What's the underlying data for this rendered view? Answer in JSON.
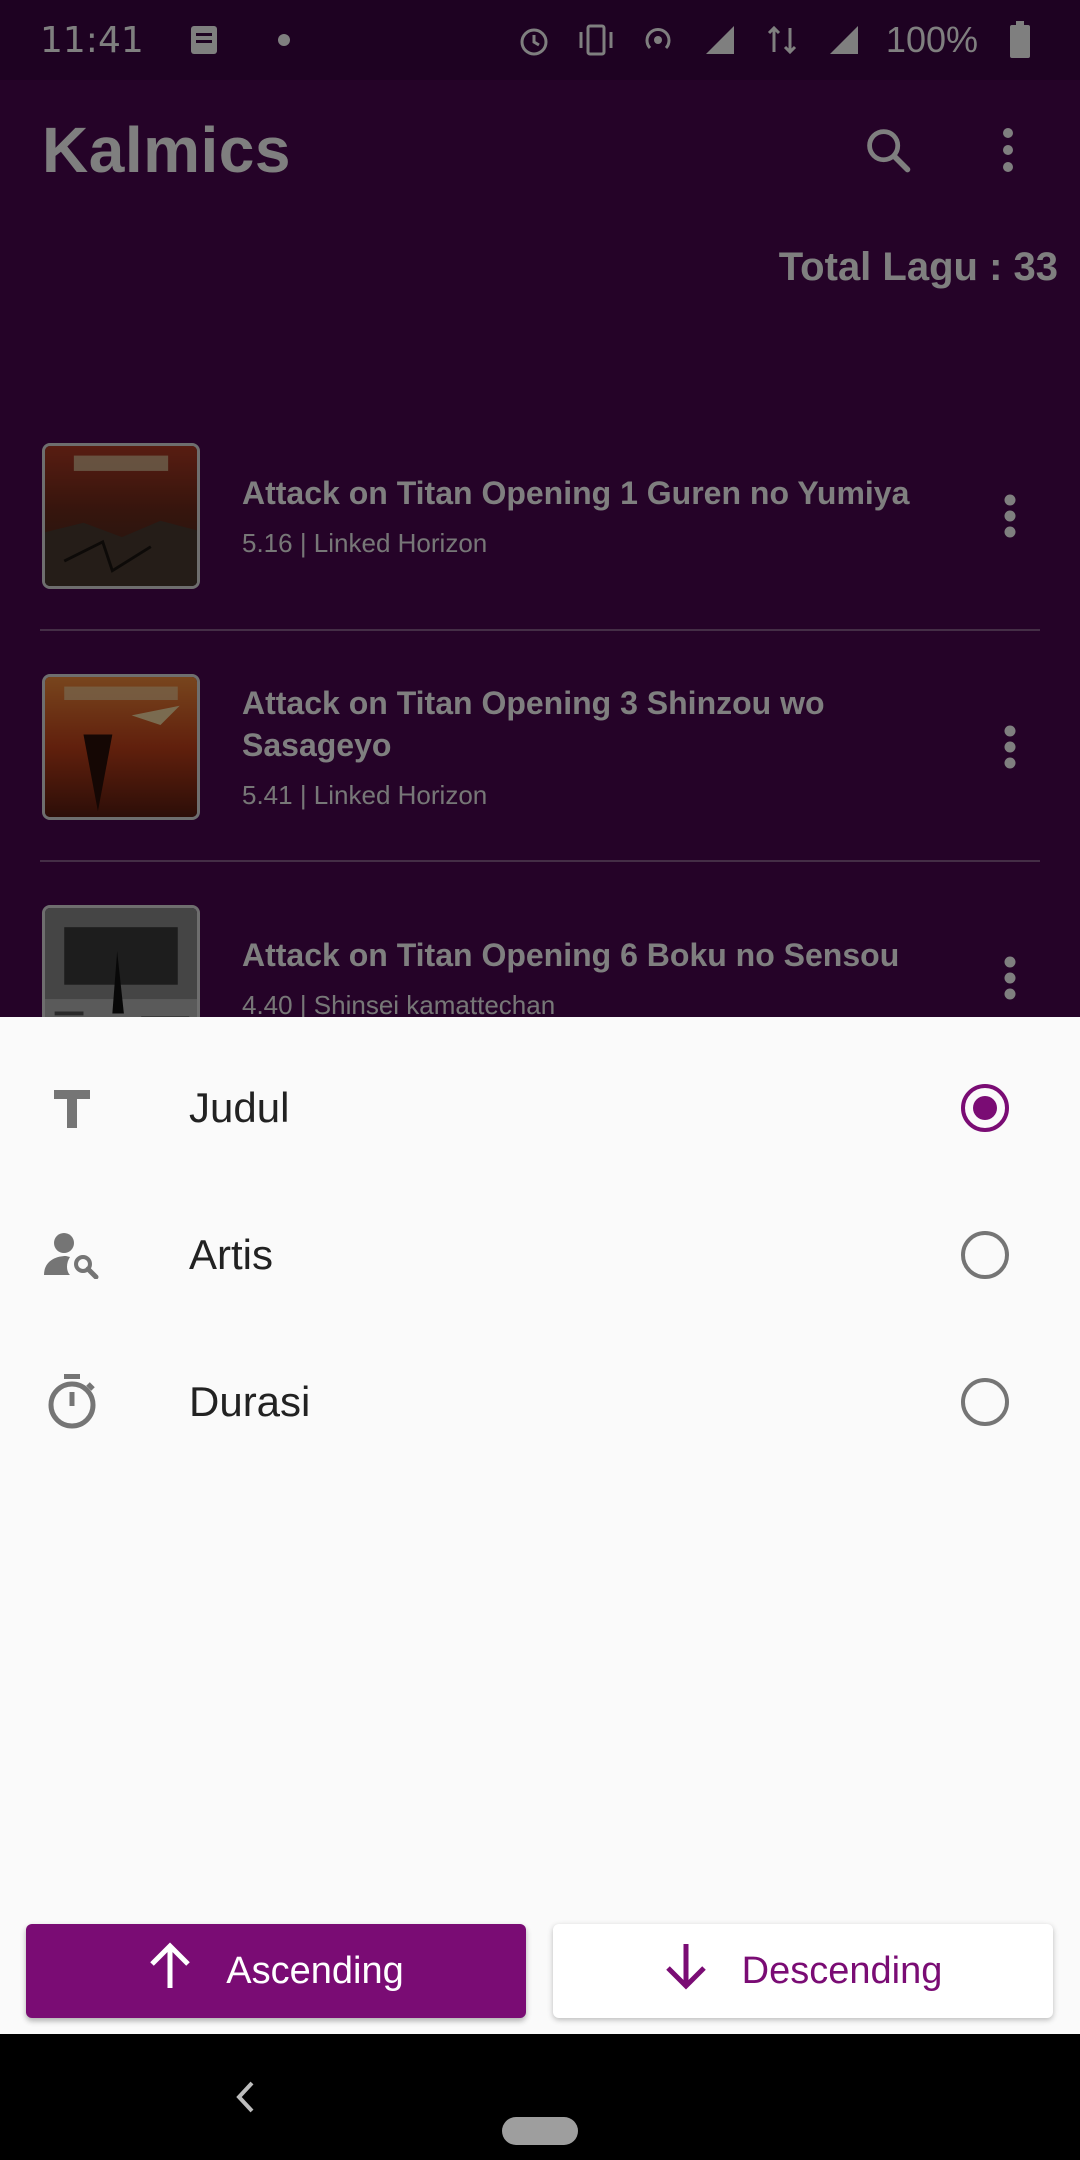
{
  "status_bar": {
    "time": "11:41",
    "battery_text": "100%",
    "icons": [
      "sim-card-icon",
      "dot-icon",
      "alarm-icon",
      "vibrate-icon",
      "hotspot-icon",
      "signal-off-icon",
      "data-icon",
      "signal-icon",
      "battery-icon"
    ]
  },
  "app_bar": {
    "title": "Kalmics",
    "search_icon": "search-icon",
    "overflow_icon": "more-vert-icon"
  },
  "total": {
    "text": "Total Lagu : 33"
  },
  "songs": [
    {
      "title": "Attack on Titan Opening 1 Guren no Yumiya",
      "meta": "5.16 | Linked Horizon"
    },
    {
      "title": "Attack on Titan Opening 3 Shinzou wo Sasageyo",
      "meta": "5.41 | Linked Horizon"
    },
    {
      "title": "Attack on Titan Opening 6 Boku no Sensou",
      "meta": "4.40 | Shinsei kamattechan"
    }
  ],
  "sort_sheet": {
    "options": [
      {
        "label": "Judul",
        "icon": "text-icon",
        "selected": true
      },
      {
        "label": "Artis",
        "icon": "person-search-icon",
        "selected": false
      },
      {
        "label": "Durasi",
        "icon": "timer-icon",
        "selected": false
      }
    ],
    "ascending_label": "Ascending",
    "descending_label": "Descending"
  },
  "colors": {
    "primary": "#7a0c74",
    "app_background": "#4a0750",
    "sheet_background": "#fafafa"
  }
}
